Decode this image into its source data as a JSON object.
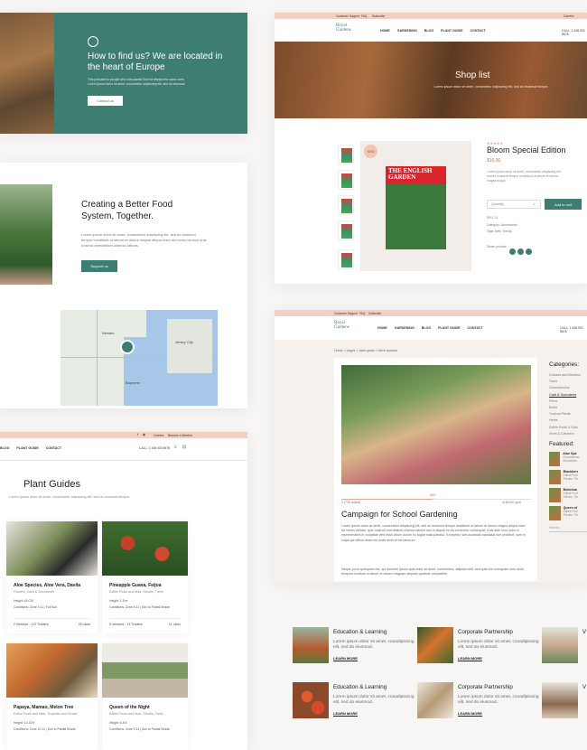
{
  "colors": {
    "accent": "#3d7d72",
    "peach": "#f4d0c0",
    "coral": "#e06a54"
  },
  "hero": {
    "title": "How to find us? We are located in the heart of Europe",
    "text": "This podcast for people who love plants! But not always the same ones.\nLorem ipsum dolor sit amet, consectetur adipiscing elit, sed do eiusmod.",
    "button": "Contact us"
  },
  "about": {
    "title": "Creating a Better Food System, Together.",
    "text": "Lorem ipsum dolor sit amet, consectetur adipiscing elit, sed do eiusmod tempor incididunt ut labore et dolore magna aliqua enim ad minim veniam quis nostrud exercitation ullamco laboris.",
    "button": "Support us"
  },
  "map": {
    "labels": [
      "Newark",
      "Jersey City",
      "Bayonne"
    ]
  },
  "shop": {
    "topbar": [
      "Customer Support",
      "FAQ",
      "Subscribe"
    ],
    "topbar_right": "Careers",
    "logo": "Royal Gardens",
    "nav": [
      "HOME",
      "GARDENING",
      "BLOG",
      "PLANT GUIDE",
      "CONTACT"
    ],
    "phone": "CALL: 1 348 033 5678",
    "banner_title": "Shop list",
    "banner_sub": "Lorem ipsum dolor sit amet, consectetur adipiscing elit, sed do eiusmod tempor.",
    "badge": "NEW",
    "product_title": "Bloom Special Edition",
    "price": "$16.00",
    "desc": "Lorem ipsum dolor sit amet, consectetur adipiscing elit, sed do eiusmod tempor incididunt ut labore et dolore magna aliqua.",
    "quantity_label": "Quantity",
    "quantity": "1",
    "add_to_cart": "Add to cart",
    "sku": "SKU: 11",
    "categories": "Category: Accessories",
    "tags": "Tags: New, Trendy",
    "share": "Share product:",
    "magazine": "THE ENGLISH GARDEN"
  },
  "guides": {
    "topbar_items": [
      "Careers",
      "Become a Member"
    ],
    "nav": [
      "BLOG",
      "PLANT GUIDE",
      "CONTACT"
    ],
    "phone": "CALL: 1 348 033 5678",
    "title": "Plant Guides",
    "sub": "Lorem ipsum dolor sit amet, consectetur adipiscing elit, sed do eiusmod tempor",
    "cards": [
      {
        "name": "Aloe Species, Aloe Vera, Davila",
        "sub": "Flowers, Cacti & Succulents",
        "height": "Height: 45 CM",
        "cond": "Conditions: Zone 9-11 | Full Sun",
        "f1": "2 Vendors · 172 Traders",
        "f2": "25 Likes"
      },
      {
        "name": "Pineapple Guava, Feijoa",
        "sub": "Edible Fruits and Nuts, Shrubs, Trees",
        "height": "Height: 1-5 m",
        "cond": "Conditions: Zone 8-11 | Sun to Partial Shade",
        "f1": "3 Vendors · 13 Traders",
        "f2": "11 Likes"
      },
      {
        "name": "Papaya, Mamao, Melon Tree",
        "sub": "Edible Fruits and Nuts, Tropicals and Tender",
        "height": "Height: 10-20 ft",
        "cond": "Conditions: Zone 10-11 | Sun to Partial Shade",
        "f1": "",
        "f2": ""
      },
      {
        "name": "Queen of the Night",
        "sub": "Edible Fruits and Nuts, Shrubs, Trees",
        "height": "Height: 6-8 ft",
        "cond": "Conditions: Zone 9-11 | Sun to Partial Shade",
        "f1": "",
        "f2": ""
      }
    ]
  },
  "campaign": {
    "topbar": [
      "Customer Support",
      "FAQ",
      "Subscribe"
    ],
    "nav": [
      "HOME",
      "GARDENING",
      "BLOG",
      "PLANT GUIDE",
      "CONTACT"
    ],
    "phone": "CALL: 1 348 033 5678",
    "breadcrumb": "Home > pages > plant guide > Alive species",
    "raised": "3 (72K raised)",
    "goal": "of $100K goal",
    "percent": "48%",
    "title": "Campaign for School Gardening",
    "body": "Lorem ipsum dolor sit amet, consectetur adipiscing elit, sed do eiusmod tempor incididunt ut labore et dolore magna aliqua enim ad minim veniam, quis nostrud exercitation ullamco laboris nisi ut aliquip ex ea commodo consequat. Duis aute irure dolor in reprehenderit in voluptate velit esse cillum dolore eu fugiat nulla pariatur. Excepteur sint occaecat cupidatat non proident, sunt in culpa qui officia deserunt mollit anim id est laborum.",
    "body2": "Neque porro quisquam est, qui dolorem ipsum quia dolor sit amet, consectetur, adipisci velit, sed quia non numquam eius modi tempora incidunt ut labore et dolore magnam aliquam quaerat voluptatem.",
    "categories_title": "Categories:",
    "categories": [
      "Grasses and Bamboo",
      "Trees",
      "Groundcovers",
      "Cacti & Succulents",
      "Ferns",
      "Bulbs",
      "Tropical Plants",
      "Herbs",
      "Edible Fruits & Nuts",
      "Vines & Climbers"
    ],
    "featured_title": "Featured:",
    "featured": [
      {
        "name": "Aloe Spe",
        "sub": "Groundcover Succulents"
      },
      {
        "name": "Blackberr",
        "sub": "Edible Fruit Shrubs, Tre"
      },
      {
        "name": "Bolchina",
        "sub": "Edible Fruit Shrubs, Tre"
      },
      {
        "name": "Queen of",
        "sub": "Edible Fruit Shrubs, Tre"
      }
    ],
    "search_placeholder": "Search..."
  },
  "education": [
    {
      "title": "Education & Learning",
      "text": "Lorem ipsum dolor sit amet, conadipiscing elit, sed do eiusmod.",
      "more": "LEARN MORE"
    },
    {
      "title": "Corporate Partnership",
      "text": "Lorem ipsum dolor sit amet, conadipiscing elit, sed do eiusmod.",
      "more": "LEARN MORE"
    },
    {
      "title": "V",
      "text": "",
      "more": ""
    },
    {
      "title": "Education & Learning",
      "text": "Lorem ipsum dolor sit amet, conadipiscing elit, sed do eiusmod.",
      "more": "LEARN MORE"
    },
    {
      "title": "Corporate Partnership",
      "text": "Lorem ipsum dolor sit amet, conadipiscing elit, sed do eiusmod.",
      "more": "LEARN MORE"
    },
    {
      "title": "V",
      "text": "",
      "more": ""
    }
  ]
}
